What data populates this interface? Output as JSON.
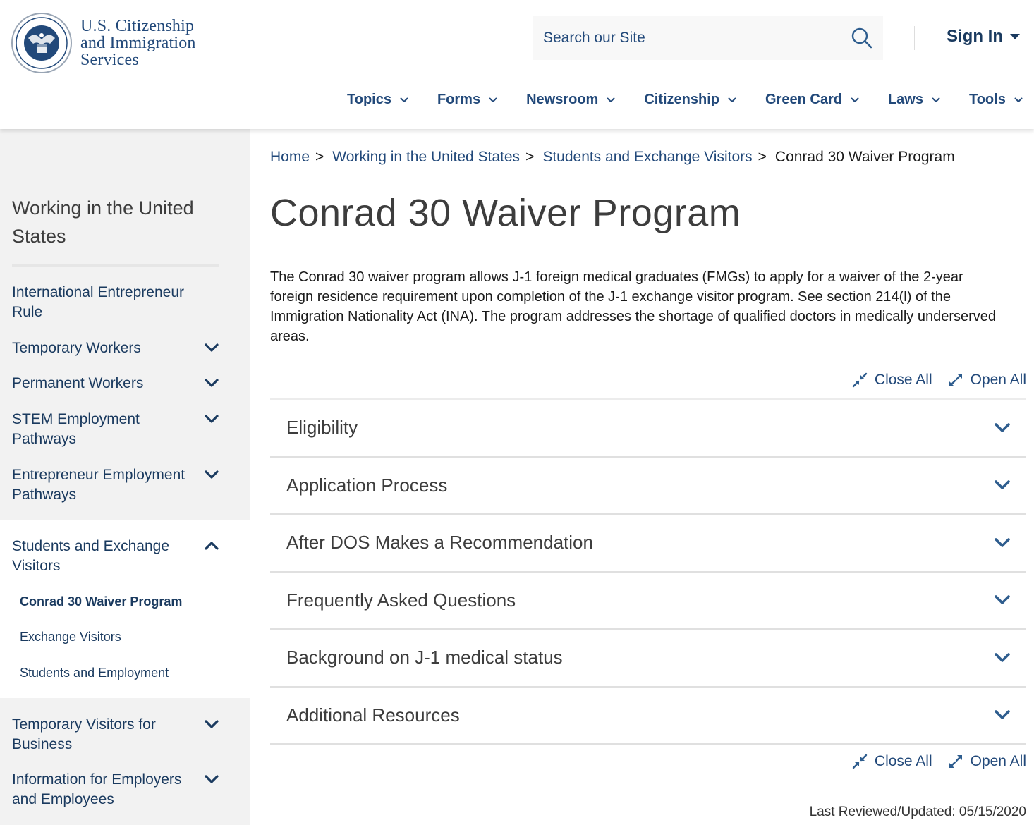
{
  "header": {
    "agency_lines": [
      "U.S. Citizenship",
      "and Immigration",
      "Services"
    ],
    "search_placeholder": "Search our Site",
    "sign_in_label": "Sign In",
    "nav": [
      {
        "label": "Topics"
      },
      {
        "label": "Forms"
      },
      {
        "label": "Newsroom"
      },
      {
        "label": "Citizenship"
      },
      {
        "label": "Green Card"
      },
      {
        "label": "Laws"
      },
      {
        "label": "Tools"
      }
    ]
  },
  "sidebar": {
    "title": "Working in the United States",
    "items": [
      {
        "label": "International Entrepreneur Rule",
        "expandable": false
      },
      {
        "label": "Temporary Workers",
        "expandable": true,
        "expanded": false
      },
      {
        "label": "Permanent Workers",
        "expandable": true,
        "expanded": false
      },
      {
        "label": "STEM Employment Pathways",
        "expandable": true,
        "expanded": false
      },
      {
        "label": "Entrepreneur Employment Pathways",
        "expandable": true,
        "expanded": false
      },
      {
        "label": "Students and Exchange Visitors",
        "expandable": true,
        "expanded": true
      },
      {
        "label": "Temporary Visitors for Business",
        "expandable": true,
        "expanded": false
      },
      {
        "label": "Information for Employers and Employees",
        "expandable": true,
        "expanded": false
      }
    ],
    "subitems": [
      {
        "label": "Conrad 30 Waiver Program",
        "active": true
      },
      {
        "label": "Exchange Visitors",
        "active": false
      },
      {
        "label": "Students and Employment",
        "active": false
      }
    ]
  },
  "main": {
    "breadcrumb": {
      "home": "Home",
      "level1": "Working in the United States",
      "level2": "Students and Exchange Visitors",
      "current": "Conrad 30 Waiver Program",
      "separator": ">"
    },
    "title": "Conrad 30 Waiver Program",
    "intro": "The Conrad 30 waiver program allows J-1 foreign medical graduates (FMGs) to apply for a waiver of the 2-year foreign residence requirement upon completion of the J-1 exchange visitor program. See section 214(l) of the Immigration Nationality Act (INA). The program addresses the shortage of qualified doctors in medically underserved areas.",
    "close_all_label": "Close All",
    "open_all_label": "Open All",
    "accordion": [
      {
        "label": "Eligibility"
      },
      {
        "label": "Application Process"
      },
      {
        "label": "After DOS Makes a Recommendation"
      },
      {
        "label": "Frequently Asked Questions"
      },
      {
        "label": "Background on J-1 medical status"
      },
      {
        "label": "Additional Resources"
      }
    ],
    "last_reviewed_label": "Last Reviewed/Updated:",
    "last_reviewed_date": "05/15/2020"
  },
  "colors": {
    "brand_navy": "#22497a",
    "dark_navy": "#1a3a5f",
    "sidebar_bg": "#f2f2f2",
    "accent_chevron": "#2e5d8e"
  }
}
